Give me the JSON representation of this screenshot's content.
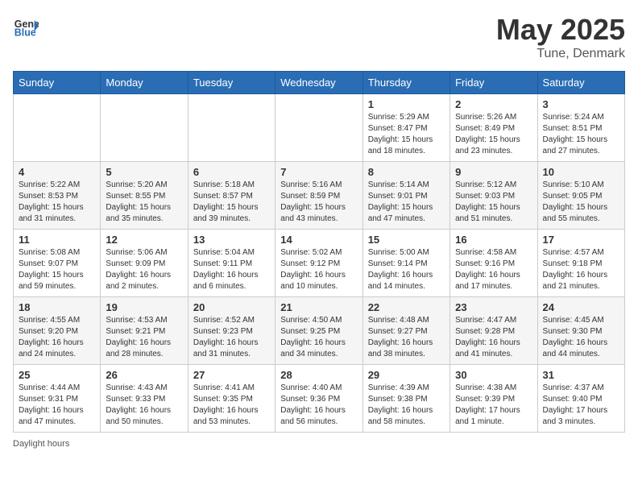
{
  "header": {
    "logo_general": "General",
    "logo_blue": "Blue",
    "title": "May 2025",
    "location": "Tune, Denmark"
  },
  "weekdays": [
    "Sunday",
    "Monday",
    "Tuesday",
    "Wednesday",
    "Thursday",
    "Friday",
    "Saturday"
  ],
  "weeks": [
    [
      {
        "day": "",
        "info": ""
      },
      {
        "day": "",
        "info": ""
      },
      {
        "day": "",
        "info": ""
      },
      {
        "day": "",
        "info": ""
      },
      {
        "day": "1",
        "info": "Sunrise: 5:29 AM\nSunset: 8:47 PM\nDaylight: 15 hours\nand 18 minutes."
      },
      {
        "day": "2",
        "info": "Sunrise: 5:26 AM\nSunset: 8:49 PM\nDaylight: 15 hours\nand 23 minutes."
      },
      {
        "day": "3",
        "info": "Sunrise: 5:24 AM\nSunset: 8:51 PM\nDaylight: 15 hours\nand 27 minutes."
      }
    ],
    [
      {
        "day": "4",
        "info": "Sunrise: 5:22 AM\nSunset: 8:53 PM\nDaylight: 15 hours\nand 31 minutes."
      },
      {
        "day": "5",
        "info": "Sunrise: 5:20 AM\nSunset: 8:55 PM\nDaylight: 15 hours\nand 35 minutes."
      },
      {
        "day": "6",
        "info": "Sunrise: 5:18 AM\nSunset: 8:57 PM\nDaylight: 15 hours\nand 39 minutes."
      },
      {
        "day": "7",
        "info": "Sunrise: 5:16 AM\nSunset: 8:59 PM\nDaylight: 15 hours\nand 43 minutes."
      },
      {
        "day": "8",
        "info": "Sunrise: 5:14 AM\nSunset: 9:01 PM\nDaylight: 15 hours\nand 47 minutes."
      },
      {
        "day": "9",
        "info": "Sunrise: 5:12 AM\nSunset: 9:03 PM\nDaylight: 15 hours\nand 51 minutes."
      },
      {
        "day": "10",
        "info": "Sunrise: 5:10 AM\nSunset: 9:05 PM\nDaylight: 15 hours\nand 55 minutes."
      }
    ],
    [
      {
        "day": "11",
        "info": "Sunrise: 5:08 AM\nSunset: 9:07 PM\nDaylight: 15 hours\nand 59 minutes."
      },
      {
        "day": "12",
        "info": "Sunrise: 5:06 AM\nSunset: 9:09 PM\nDaylight: 16 hours\nand 2 minutes."
      },
      {
        "day": "13",
        "info": "Sunrise: 5:04 AM\nSunset: 9:11 PM\nDaylight: 16 hours\nand 6 minutes."
      },
      {
        "day": "14",
        "info": "Sunrise: 5:02 AM\nSunset: 9:12 PM\nDaylight: 16 hours\nand 10 minutes."
      },
      {
        "day": "15",
        "info": "Sunrise: 5:00 AM\nSunset: 9:14 PM\nDaylight: 16 hours\nand 14 minutes."
      },
      {
        "day": "16",
        "info": "Sunrise: 4:58 AM\nSunset: 9:16 PM\nDaylight: 16 hours\nand 17 minutes."
      },
      {
        "day": "17",
        "info": "Sunrise: 4:57 AM\nSunset: 9:18 PM\nDaylight: 16 hours\nand 21 minutes."
      }
    ],
    [
      {
        "day": "18",
        "info": "Sunrise: 4:55 AM\nSunset: 9:20 PM\nDaylight: 16 hours\nand 24 minutes."
      },
      {
        "day": "19",
        "info": "Sunrise: 4:53 AM\nSunset: 9:21 PM\nDaylight: 16 hours\nand 28 minutes."
      },
      {
        "day": "20",
        "info": "Sunrise: 4:52 AM\nSunset: 9:23 PM\nDaylight: 16 hours\nand 31 minutes."
      },
      {
        "day": "21",
        "info": "Sunrise: 4:50 AM\nSunset: 9:25 PM\nDaylight: 16 hours\nand 34 minutes."
      },
      {
        "day": "22",
        "info": "Sunrise: 4:48 AM\nSunset: 9:27 PM\nDaylight: 16 hours\nand 38 minutes."
      },
      {
        "day": "23",
        "info": "Sunrise: 4:47 AM\nSunset: 9:28 PM\nDaylight: 16 hours\nand 41 minutes."
      },
      {
        "day": "24",
        "info": "Sunrise: 4:45 AM\nSunset: 9:30 PM\nDaylight: 16 hours\nand 44 minutes."
      }
    ],
    [
      {
        "day": "25",
        "info": "Sunrise: 4:44 AM\nSunset: 9:31 PM\nDaylight: 16 hours\nand 47 minutes."
      },
      {
        "day": "26",
        "info": "Sunrise: 4:43 AM\nSunset: 9:33 PM\nDaylight: 16 hours\nand 50 minutes."
      },
      {
        "day": "27",
        "info": "Sunrise: 4:41 AM\nSunset: 9:35 PM\nDaylight: 16 hours\nand 53 minutes."
      },
      {
        "day": "28",
        "info": "Sunrise: 4:40 AM\nSunset: 9:36 PM\nDaylight: 16 hours\nand 56 minutes."
      },
      {
        "day": "29",
        "info": "Sunrise: 4:39 AM\nSunset: 9:38 PM\nDaylight: 16 hours\nand 58 minutes."
      },
      {
        "day": "30",
        "info": "Sunrise: 4:38 AM\nSunset: 9:39 PM\nDaylight: 17 hours\nand 1 minute."
      },
      {
        "day": "31",
        "info": "Sunrise: 4:37 AM\nSunset: 9:40 PM\nDaylight: 17 hours\nand 3 minutes."
      }
    ]
  ],
  "footer": {
    "label": "Daylight hours"
  }
}
